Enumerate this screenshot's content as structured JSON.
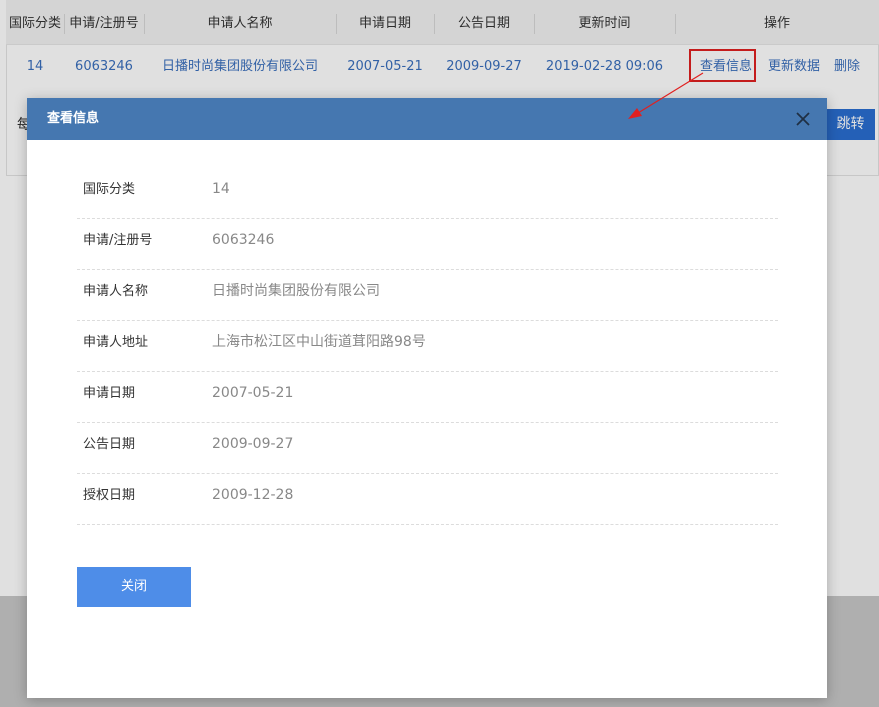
{
  "table": {
    "headers": [
      "国际分类",
      "申请/注册号",
      "申请人名称",
      "申请日期",
      "公告日期",
      "更新时间",
      "操作"
    ],
    "row": {
      "intl_class": "14",
      "reg_no": "6063246",
      "applicant": "日播时尚集团股份有限公司",
      "apply_date": "2007-05-21",
      "notice_date": "2009-09-27",
      "update_time": "2019-02-28 09:06"
    },
    "actions": {
      "view": "查看信息",
      "update": "更新数据",
      "delete": "删除"
    }
  },
  "pager": {
    "peek_text": "每",
    "jump_label": "跳转"
  },
  "modal": {
    "title": "查看信息",
    "close_icon": "close-icon",
    "fields": [
      {
        "label": "国际分类",
        "value": "14"
      },
      {
        "label": "申请/注册号",
        "value": "6063246"
      },
      {
        "label": "申请人名称",
        "value": "日播时尚集团股份有限公司"
      },
      {
        "label": "申请人地址",
        "value": "上海市松江区中山街道茸阳路98号"
      },
      {
        "label": "申请日期",
        "value": "2007-05-21"
      },
      {
        "label": "公告日期",
        "value": "2009-09-27"
      },
      {
        "label": "授权日期",
        "value": "2009-12-28"
      }
    ],
    "close_button": "关闭"
  },
  "colors": {
    "header_blue": "#4577b0",
    "button_blue": "#4e8de8",
    "link_blue": "#3a6fbd",
    "annotation_red": "#e02020"
  }
}
